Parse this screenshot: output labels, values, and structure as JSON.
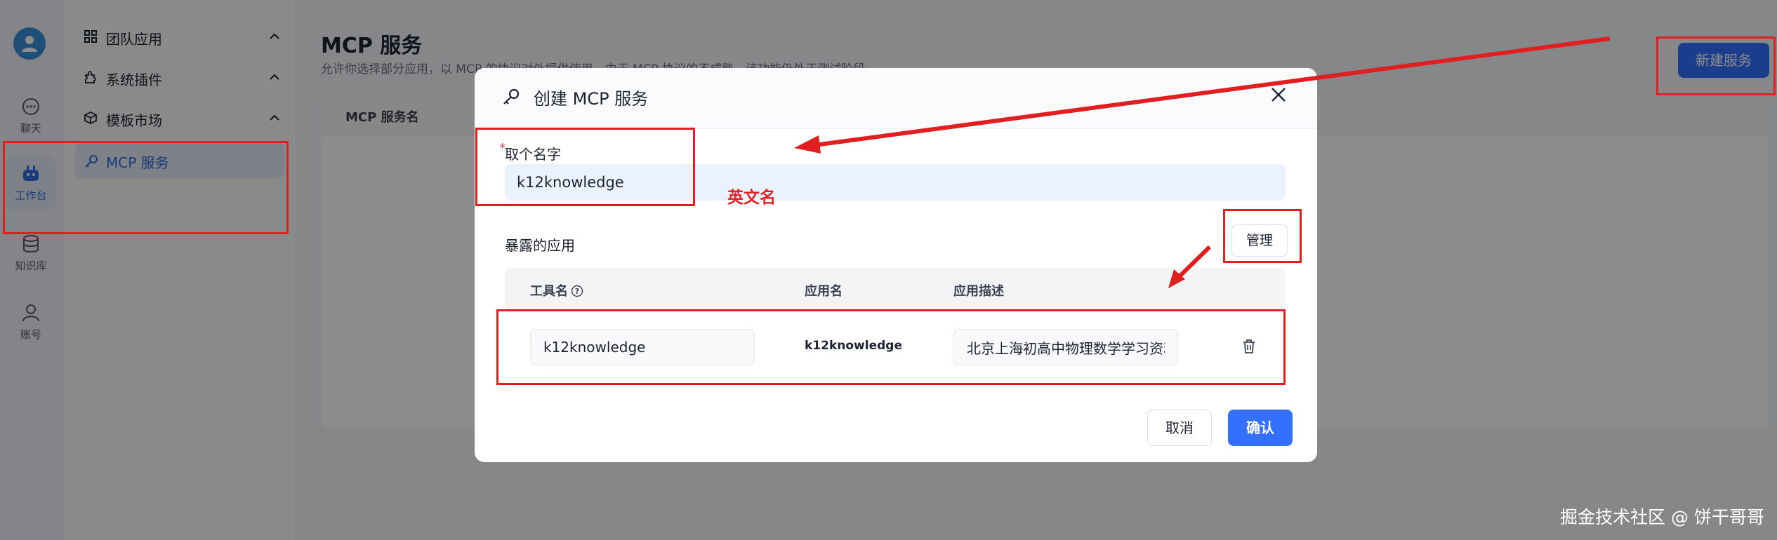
{
  "rail": {
    "items": [
      {
        "label": "聊天"
      },
      {
        "label": "工作台"
      },
      {
        "label": "知识库"
      },
      {
        "label": "账号"
      }
    ]
  },
  "nav": {
    "groups": [
      {
        "label": "团队应用"
      },
      {
        "label": "系统插件"
      },
      {
        "label": "模板市场"
      }
    ],
    "active_item": "MCP 服务"
  },
  "page": {
    "title": "MCP 服务",
    "description": "允许你选择部分应用，以 MCP 的协议对外提供使用。由于 MCP 协议的不成熟，该功能仍处于测试阶段。",
    "new_button": "新建服务",
    "table_header": "MCP 服务名"
  },
  "modal": {
    "title": "创建 MCP 服务",
    "required_mark": "*",
    "name_label": "取个名字",
    "name_value": "k12knowledge",
    "apps_label": "暴露的应用",
    "manage_button": "管理",
    "columns": {
      "tool": "工具名",
      "app": "应用名",
      "desc": "应用描述"
    },
    "row": {
      "tool_name": "k12knowledge",
      "app_name": "k12knowledge",
      "app_desc": "北京上海初高中物理数学学习资料"
    },
    "cancel_button": "取消",
    "confirm_button": "确认"
  },
  "annotation": {
    "note": "英文名",
    "color": "#e02020"
  },
  "watermark": "掘金技术社区 @ 饼干哥哥",
  "colors": {
    "primary": "#3370ff",
    "overlay": "rgba(0,0,0,0.45)"
  }
}
